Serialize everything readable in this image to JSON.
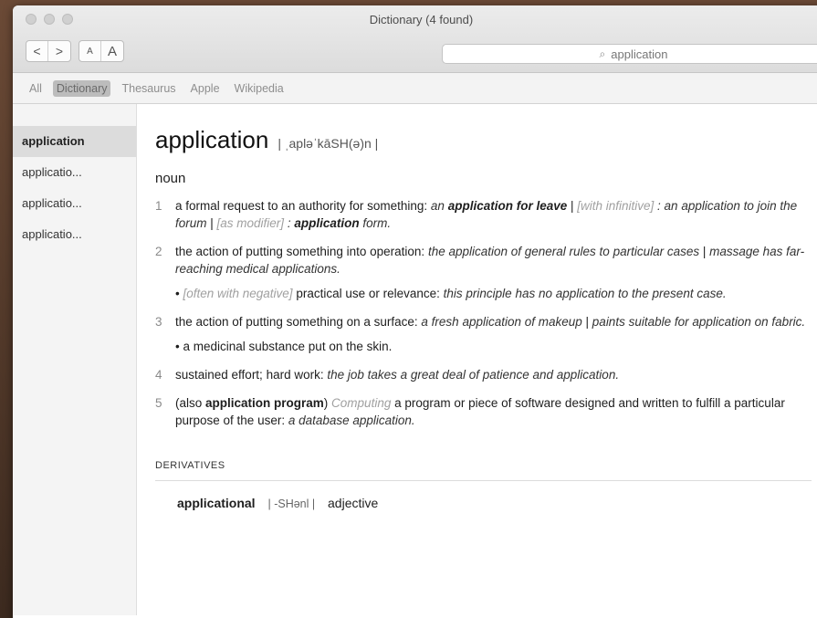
{
  "window": {
    "title": "Dictionary (4 found)"
  },
  "toolbar": {
    "back": "<",
    "forward": ">",
    "font_smaller": "A",
    "font_larger": "A"
  },
  "search": {
    "value": "application",
    "clear": "×"
  },
  "tabs": [
    "All",
    "Dictionary",
    "Thesaurus",
    "Apple",
    "Wikipedia"
  ],
  "sidebar": {
    "items": [
      "application",
      "applicatio...",
      "applicatio...",
      "applicatio..."
    ]
  },
  "entry": {
    "headword": "application",
    "pronunciation": "| ˌapləˈkāSH(ə)n |",
    "pos": "noun",
    "senses": [
      {
        "num": "1",
        "parts": [
          {
            "t": "a formal request to an authority for something: "
          },
          {
            "t": "an ",
            "c": "ex"
          },
          {
            "t": "application for leave",
            "c": "b"
          },
          {
            "t": " | "
          },
          {
            "t": "[with infinitive]",
            "c": "gram"
          },
          {
            "t": " : an application to join the forum",
            "c": "ex"
          },
          {
            "t": " | "
          },
          {
            "t": "[as modifier]",
            "c": "gram"
          },
          {
            "t": " : ",
            "c": "ex"
          },
          {
            "t": "application",
            "c": "b"
          },
          {
            "t": " form.",
            "c": "ex"
          }
        ]
      },
      {
        "num": "2",
        "parts": [
          {
            "t": "the action of putting something into operation: "
          },
          {
            "t": "the application of general rules to particular cases",
            "c": "ex"
          },
          {
            "t": " | "
          },
          {
            "t": "massage has far-reaching medical applications.",
            "c": "ex"
          }
        ],
        "sub": [
          {
            "t": "• "
          },
          {
            "t": "[often with negative]",
            "c": "gram"
          },
          {
            "t": " practical use or relevance: "
          },
          {
            "t": "this principle has no application to the present case.",
            "c": "ex"
          }
        ]
      },
      {
        "num": "3",
        "parts": [
          {
            "t": "the action of putting something on a surface: "
          },
          {
            "t": "a fresh application of makeup",
            "c": "ex"
          },
          {
            "t": " | "
          },
          {
            "t": "paints suitable for application on fabric.",
            "c": "ex"
          }
        ],
        "sub": [
          {
            "t": "• a medicinal substance put on the skin."
          }
        ]
      },
      {
        "num": "4",
        "parts": [
          {
            "t": "sustained effort; hard work: "
          },
          {
            "t": "the job takes a great deal of patience and application.",
            "c": "ex"
          }
        ]
      },
      {
        "num": "5",
        "parts": [
          {
            "t": "(also "
          },
          {
            "t": "application program",
            "c": "bold"
          },
          {
            "t": ") "
          },
          {
            "t": "Computing",
            "c": "gram"
          },
          {
            "t": " a program or piece of software designed and written to fulfill a particular purpose of the user: "
          },
          {
            "t": "a database application.",
            "c": "ex"
          }
        ]
      }
    ],
    "derivatives_label": "DERIVATIVES",
    "derivative": {
      "word": "applicational",
      "pron": "| -SHənl |",
      "pos": "adjective"
    }
  }
}
